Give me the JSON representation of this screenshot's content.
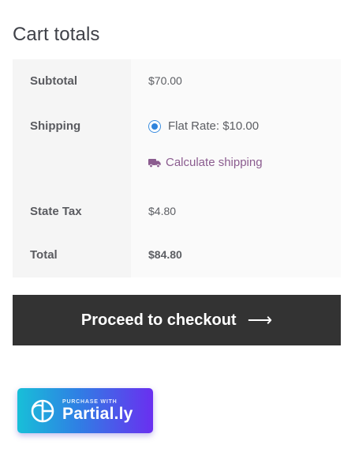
{
  "title": "Cart totals",
  "rows": {
    "subtotal": {
      "label": "Subtotal",
      "value": "$70.00"
    },
    "shipping": {
      "label": "Shipping",
      "option": "Flat Rate: $10.00",
      "option_selected": true,
      "calculate_link": "Calculate shipping"
    },
    "tax": {
      "label": "State Tax",
      "value": "$4.80"
    },
    "total": {
      "label": "Total",
      "value": "$84.80"
    }
  },
  "checkout": {
    "label": "Proceed to checkout",
    "icon": "arrow-right-icon"
  },
  "partially": {
    "caption": "PURCHASE WITH",
    "brand": "Partial.ly"
  },
  "colors": {
    "button": "#333333",
    "link": "#8b5c8f",
    "radio": "#2f84dc",
    "gradient_start": "#18bfd8",
    "gradient_end": "#6a2ff0"
  }
}
